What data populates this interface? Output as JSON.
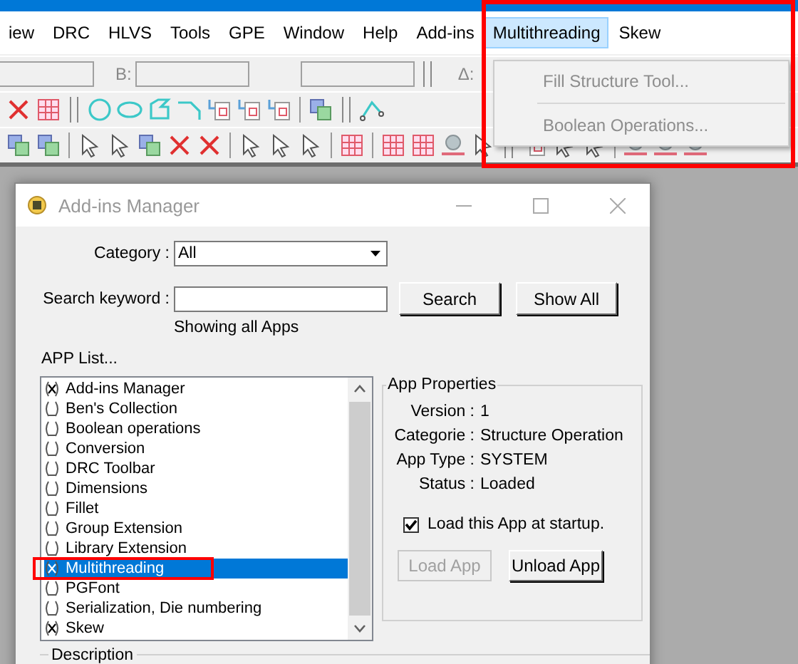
{
  "menu_bar": {
    "items": [
      {
        "label": "iew",
        "selected": false,
        "highlighted": false
      },
      {
        "label": "DRC",
        "selected": false,
        "highlighted": false
      },
      {
        "label": "HLVS",
        "selected": false,
        "highlighted": false
      },
      {
        "label": "Tools",
        "selected": false,
        "highlighted": false
      },
      {
        "label": "GPE",
        "selected": false,
        "highlighted": false
      },
      {
        "label": "Window",
        "selected": false,
        "highlighted": false
      },
      {
        "label": "Help",
        "selected": false,
        "highlighted": false
      },
      {
        "label": "Add-ins",
        "selected": false,
        "highlighted": false
      },
      {
        "label": "Multithreading",
        "selected": true,
        "highlighted": true
      },
      {
        "label": "Skew",
        "selected": false,
        "highlighted": false
      }
    ]
  },
  "toolbar": {
    "field_labels": [
      "B:",
      "Δ:"
    ]
  },
  "dropdown": {
    "items": [
      {
        "label": "Fill Structure Tool...",
        "disabled": true
      },
      {
        "label": "Boolean Operations...",
        "disabled": true
      }
    ]
  },
  "dialog": {
    "title": "Add-ins Manager",
    "category": {
      "label": "Category :",
      "value": "All"
    },
    "search": {
      "label": "Search keyword :"
    },
    "buttons": [
      {
        "label": "Search"
      },
      {
        "label": "Show All"
      }
    ],
    "status": "Showing all Apps",
    "app_list": {
      "label": "APP List...",
      "items": [
        {
          "name": "Add-ins Manager",
          "checked": true,
          "selected": false,
          "highlighted": false
        },
        {
          "name": "Ben's Collection",
          "checked": false,
          "selected": false,
          "highlighted": false
        },
        {
          "name": "Boolean operations",
          "checked": false,
          "selected": false,
          "highlighted": false
        },
        {
          "name": "Conversion",
          "checked": false,
          "selected": false,
          "highlighted": false
        },
        {
          "name": "DRC Toolbar",
          "checked": false,
          "selected": false,
          "highlighted": false
        },
        {
          "name": "Dimensions",
          "checked": false,
          "selected": false,
          "highlighted": false
        },
        {
          "name": "Fillet",
          "checked": false,
          "selected": false,
          "highlighted": false
        },
        {
          "name": "Group Extension",
          "checked": false,
          "selected": false,
          "highlighted": false
        },
        {
          "name": "Library Extension",
          "checked": false,
          "selected": false,
          "highlighted": false
        },
        {
          "name": "Multithreading",
          "checked": true,
          "selected": true,
          "highlighted": true
        },
        {
          "name": "PGFont",
          "checked": false,
          "selected": false,
          "highlighted": false
        },
        {
          "name": "Serialization, Die numbering",
          "checked": false,
          "selected": false,
          "highlighted": false
        },
        {
          "name": "Skew",
          "checked": true,
          "selected": false,
          "highlighted": false
        }
      ]
    },
    "app_properties": {
      "title": "App Properties",
      "fields": [
        {
          "label": "Version :",
          "value": "1"
        },
        {
          "label": "Categorie :",
          "value": "Structure Operation"
        },
        {
          "label": "App Type :",
          "value": "SYSTEM"
        },
        {
          "label": "Status :",
          "value": "Loaded"
        }
      ],
      "load_at_startup": {
        "label": "Load this App at startup.",
        "checked": true
      },
      "buttons": [
        {
          "label": "Load App",
          "disabled": true
        },
        {
          "label": "Unload App",
          "disabled": false
        }
      ]
    },
    "description": {
      "title": "Description"
    }
  }
}
